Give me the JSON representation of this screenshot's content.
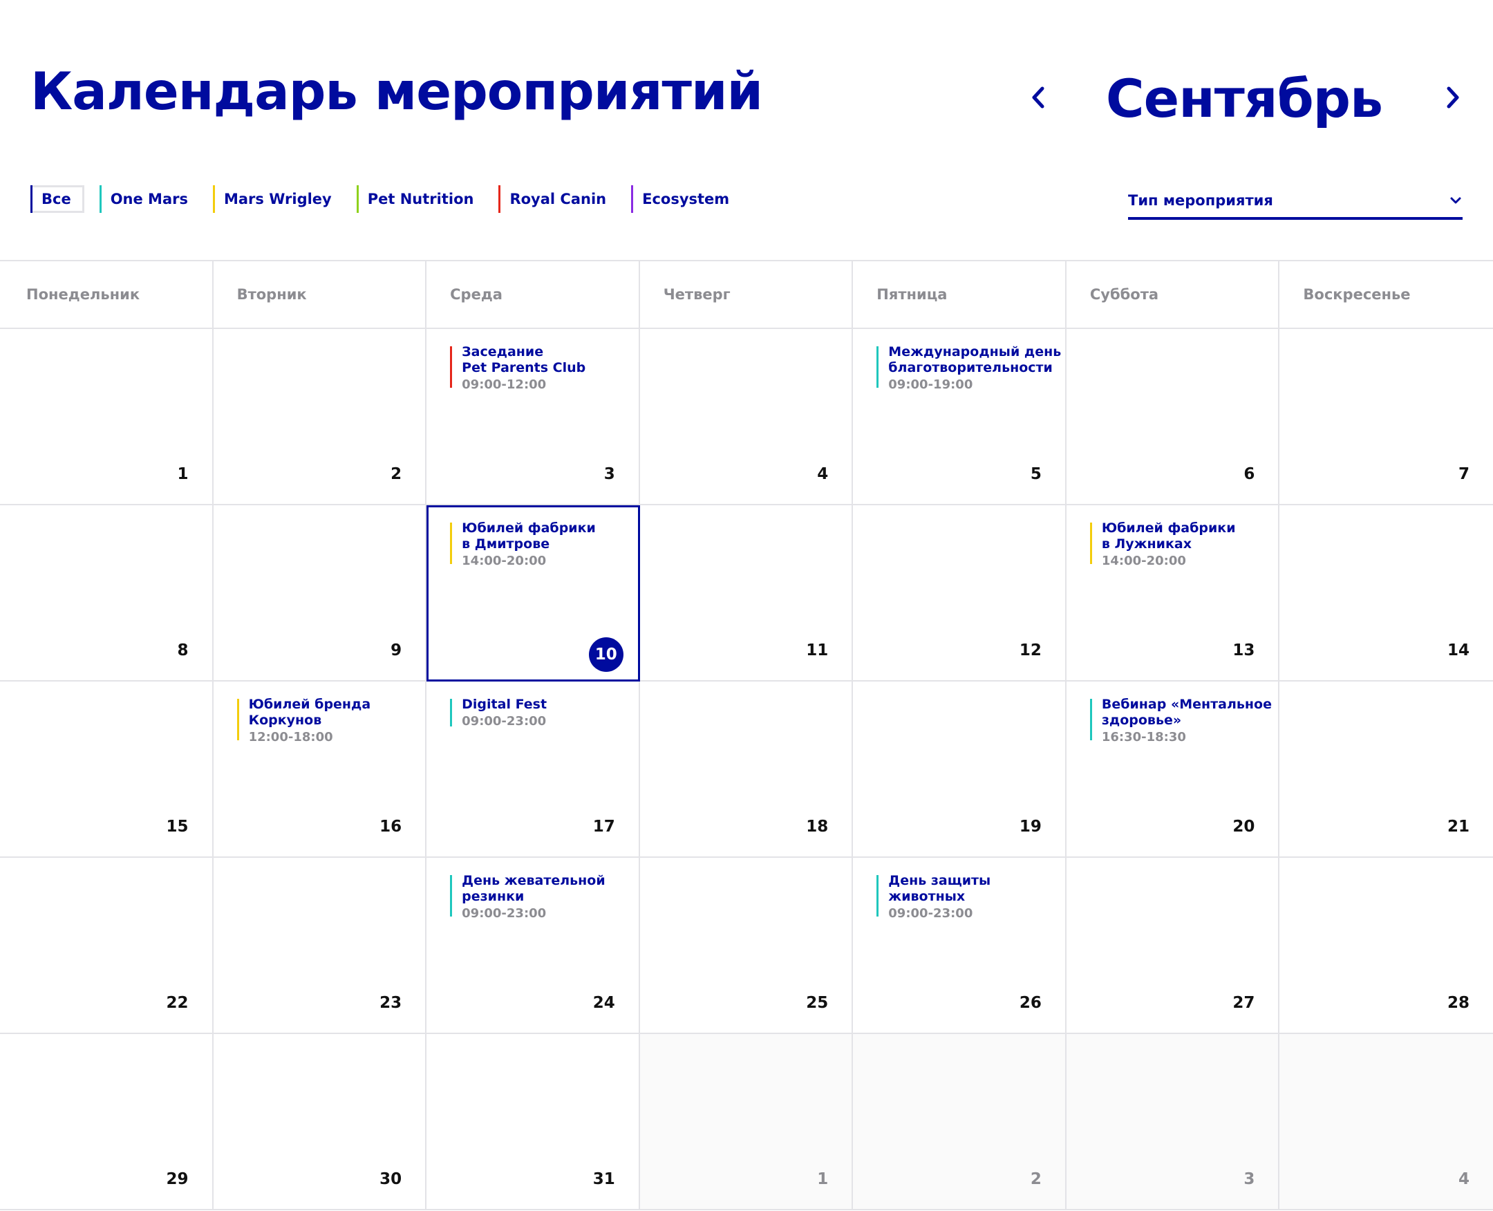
{
  "page_title": "Календарь мероприятий",
  "month": {
    "label": "Сентябрь",
    "prev_icon": "chevron-left-icon",
    "next_icon": "chevron-right-icon"
  },
  "filters": [
    {
      "label": "Все",
      "color": "#000b9e",
      "active": true
    },
    {
      "label": "One Mars",
      "color": "#1fc7bd",
      "active": false
    },
    {
      "label": "Mars Wrigley",
      "color": "#f3cd0d",
      "active": false
    },
    {
      "label": "Pet Nutrition",
      "color": "#8fd11d",
      "active": false
    },
    {
      "label": "Royal Canin",
      "color": "#e5271b",
      "active": false
    },
    {
      "label": "Ecosystem",
      "color": "#8a2be2",
      "active": false
    }
  ],
  "event_type_select": {
    "label": "Тип мероприятия",
    "icon": "chevron-down-icon"
  },
  "weekdays": [
    "Понедельник",
    "Вторник",
    "Среда",
    "Четверг",
    "Пятница",
    "Суббота",
    "Воскресенье"
  ],
  "days": [
    {
      "num": "1"
    },
    {
      "num": "2"
    },
    {
      "num": "3",
      "event": {
        "title": "Заседание\nPet Parents Club",
        "time": "09:00-12:00",
        "color": "#e5271b"
      }
    },
    {
      "num": "4"
    },
    {
      "num": "5",
      "event": {
        "title": "Международный день\nблаготворительности",
        "time": "09:00-19:00",
        "color": "#1fc7bd"
      }
    },
    {
      "num": "6"
    },
    {
      "num": "7"
    },
    {
      "num": "8"
    },
    {
      "num": "9"
    },
    {
      "num": "10",
      "today": true,
      "event": {
        "title": "Юбилей фабрики\nв Дмитрове",
        "time": "14:00-20:00",
        "color": "#f3cd0d"
      }
    },
    {
      "num": "11"
    },
    {
      "num": "12"
    },
    {
      "num": "13",
      "event": {
        "title": "Юбилей фабрики\nв Лужниках",
        "time": "14:00-20:00",
        "color": "#f3cd0d"
      }
    },
    {
      "num": "14"
    },
    {
      "num": "15"
    },
    {
      "num": "16",
      "event": {
        "title": "Юбилей бренда\nКоркунов",
        "time": "12:00-18:00",
        "color": "#f3cd0d"
      }
    },
    {
      "num": "17",
      "event": {
        "title": "Digital Fest",
        "time": "09:00-23:00",
        "color": "#1fc7bd",
        "single": true
      }
    },
    {
      "num": "18"
    },
    {
      "num": "19"
    },
    {
      "num": "20",
      "event": {
        "title": "Вебинар «Ментальное\nздоровье»",
        "time": "16:30-18:30",
        "color": "#1fc7bd"
      }
    },
    {
      "num": "21"
    },
    {
      "num": "22"
    },
    {
      "num": "23"
    },
    {
      "num": "24",
      "event": {
        "title": "День жевательной\nрезинки",
        "time": "09:00-23:00",
        "color": "#1fc7bd"
      }
    },
    {
      "num": "25"
    },
    {
      "num": "26",
      "event": {
        "title": "День защиты\nживотных",
        "time": "09:00-23:00",
        "color": "#1fc7bd"
      }
    },
    {
      "num": "27"
    },
    {
      "num": "28"
    },
    {
      "num": "29"
    },
    {
      "num": "30"
    },
    {
      "num": "31"
    },
    {
      "num": "1",
      "other": true
    },
    {
      "num": "2",
      "other": true
    },
    {
      "num": "3",
      "other": true
    },
    {
      "num": "4",
      "other": true
    }
  ]
}
